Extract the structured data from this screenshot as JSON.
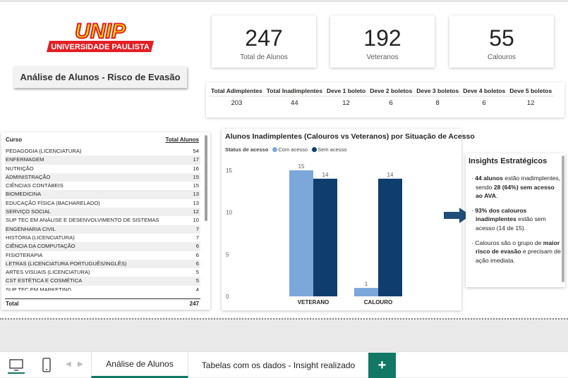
{
  "logo": {
    "brand": "UNIP",
    "subtitle": "UNIVERSIDADE PAULISTA"
  },
  "page_title": "Análise de Alunos - Risco de Evasão",
  "cards": [
    {
      "value": "247",
      "label": "Total de Alunos"
    },
    {
      "value": "192",
      "label": "Veteranos"
    },
    {
      "value": "55",
      "label": "Calouros"
    }
  ],
  "boletos": {
    "headers": [
      "Total Adimplentes",
      "Total Inadimplentes",
      "Deve 1 boleto",
      "Deve 2 boletos",
      "Deve 3 boletos",
      "Deve 4 boletos",
      "Deve 5 boletos"
    ],
    "values": [
      "203",
      "44",
      "12",
      "6",
      "8",
      "6",
      "12"
    ]
  },
  "course_table": {
    "col_course": "Curso",
    "col_total": "Total Alunos",
    "rows": [
      {
        "course": "PEDAGOGIA (LICENCIATURA)",
        "total": "54"
      },
      {
        "course": "ENFERMAGEM",
        "total": "17"
      },
      {
        "course": "NUTRIÇÃO",
        "total": "16"
      },
      {
        "course": "ADMINISTRAÇÃO",
        "total": "15"
      },
      {
        "course": "CIÊNCIAS CONTÁBEIS",
        "total": "15"
      },
      {
        "course": "BIOMEDICINA",
        "total": "13"
      },
      {
        "course": "EDUCAÇÃO FÍSICA (BACHARELADO)",
        "total": "13"
      },
      {
        "course": "SERVIÇO SOCIAL",
        "total": "12"
      },
      {
        "course": "SUP TEC EM ANÁLISE E DESENVOLVIMENTO DE SISTEMAS",
        "total": "10"
      },
      {
        "course": "ENGENHARIA CIVIL",
        "total": "7"
      },
      {
        "course": "HISTÓRIA (LICENCIATURA)",
        "total": "7"
      },
      {
        "course": "CIÊNCIA DA COMPUTAÇÃO",
        "total": "6"
      },
      {
        "course": "FISIOTERAPIA",
        "total": "6"
      },
      {
        "course": "LETRAS (LICENCIATURA PORTUGUÊS/INGLÊS)",
        "total": "6"
      },
      {
        "course": "ARTES VISUAIS (LICENCIATURA)",
        "total": "5"
      },
      {
        "course": "CST ESTÉTICA E COSMÉTICA",
        "total": "5"
      },
      {
        "course": "SUP TEC EM MARKETING",
        "total": "4"
      }
    ],
    "total_label": "Total",
    "total_value": "247"
  },
  "chart_data": {
    "type": "bar",
    "title": "Alunos Inadimplentes (Calouros vs Veteranos) por Situação de Acesso",
    "legend_title": "Status de acesso",
    "categories": [
      "VETERANO",
      "CALOURO"
    ],
    "series": [
      {
        "name": "Com acesso",
        "values": [
          15,
          1
        ],
        "color": "#7ba7db"
      },
      {
        "name": "Sem acesso",
        "values": [
          14,
          14
        ],
        "color": "#0f3e6e"
      }
    ],
    "yticks": [
      0,
      5,
      10,
      15
    ],
    "ylim": [
      0,
      16
    ]
  },
  "insights": {
    "title": "Insights Estratégicos",
    "p1_a": "44 alunos",
    "p1_b": " estão inadimplentes, sendo ",
    "p1_c": "28 (64%) sem acesso ao AVA",
    "p1_d": ".",
    "p2_a": "93% dos calouros inadimplentes",
    "p2_b": " estão sem acesso (14 de 15).",
    "p3_a": "Calouros são o grupo de ",
    "p3_b": "maior risco de evasão",
    "p3_c": " e precisam de ação imediata."
  },
  "tabs": [
    {
      "label": "Análise de Alunos"
    },
    {
      "label": "Tabelas com os dados - Insight realizado"
    }
  ],
  "add_tab": "+",
  "colors": {
    "accent": "#117865",
    "navy": "#0f3e6e",
    "light_blue": "#7ba7db",
    "unip_red": "#e31e24",
    "unip_yellow": "#f5e600"
  }
}
